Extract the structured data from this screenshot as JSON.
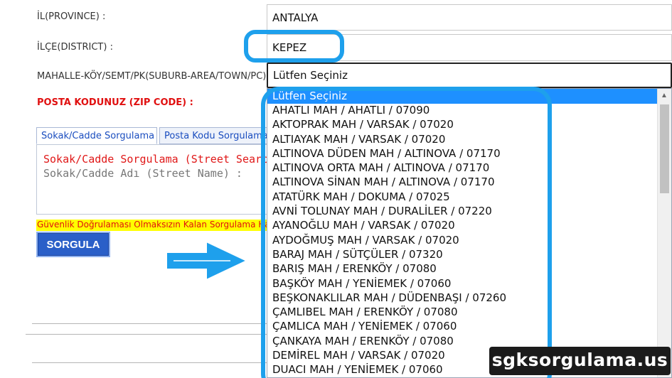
{
  "form": {
    "province_label": "İL(PROVINCE) :",
    "province_value": "ANTALYA",
    "district_label": "İLÇE(DISTRICT) :",
    "district_value": "KEPEZ",
    "suburb_label": "MAHALLE-KÖY/SEMT/PK(SUBURB-AREA/TOWN/PC) :",
    "suburb_value": "Lütfen Seçiniz",
    "zip_label": "POSTA KODUNUZ (ZIP CODE) :"
  },
  "tabs": [
    {
      "label": "Sokak/Cadde Sorgulama",
      "active": true
    },
    {
      "label": "Posta Kodu Sorgulama",
      "active": false
    }
  ],
  "panel": {
    "title": "Sokak/Cadde Sorgulama (Street Search)",
    "street_label": "Sokak/Cadde Adı (Street Name) :"
  },
  "warning_text": "Güvenlik Doğrulaması Olmaksızın Kalan Sorgulama Hakkınız",
  "query_button": "SORGULA",
  "dropdown": {
    "highlighted": "Lütfen Seçiniz",
    "items": [
      "AHATLI MAH / AHATLI / 07090",
      "AKTOPRAK MAH / VARSAK / 07020",
      "ALTIAYAK MAH / VARSAK / 07020",
      "ALTINOVA DÜDEN MAH / ALTINOVA / 07170",
      "ALTINOVA ORTA MAH / ALTINOVA / 07170",
      "ALTINOVA SİNAN MAH / ALTINOVA / 07170",
      "ATATÜRK MAH / DOKUMA / 07025",
      "AVNİ TOLUNAY MAH / DURALİLER / 07220",
      "AYANOĞLU MAH / VARSAK / 07020",
      "AYDOĞMUŞ MAH / VARSAK / 07020",
      "BARAJ MAH / SÜTÇÜLER / 07320",
      "BARIŞ MAH / ERENKÖY / 07080",
      "BAŞKÖY MAH / YENİEMEK / 07060",
      "BEŞKONAKLILAR MAH / DÜDENBAŞI / 07260",
      "ÇAMLIBEL MAH / ERENKÖY / 07080",
      "ÇAMLICA MAH / YENİEMEK / 07060",
      "ÇANKAYA MAH / ERENKÖY / 07080",
      "DEMİREL MAH / VARSAK / 07020",
      "DUACI MAH / YENİEMEK / 07060"
    ]
  },
  "watermark": "sgksorgulama.us",
  "colors": {
    "highlight_ring": "#1ea0ec",
    "button": "#2a5fc8",
    "warning_bg": "#ffff00",
    "error_text": "#e01010",
    "selected_option": "#1e90ff"
  },
  "icons": {
    "annotation_arrow": "right-arrow-icon",
    "scroll_up": "scroll-up-arrow-icon"
  }
}
